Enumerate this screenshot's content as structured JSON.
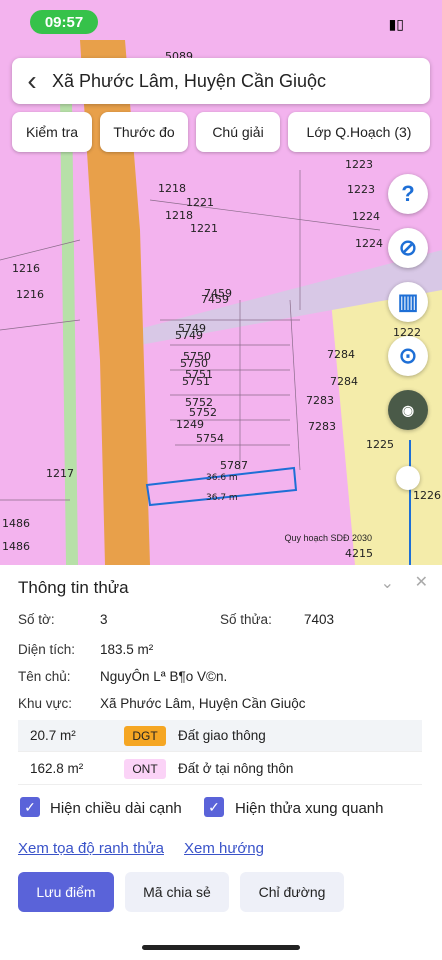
{
  "status": {
    "time": "09:57"
  },
  "header": {
    "title": "Xã Phước Lâm, Huyện Cần Giuộc"
  },
  "toolbar": {
    "check": "Kiểm tra",
    "measure": "Thước đo",
    "legend": "Chú giải",
    "layer": "Lớp Q.Hoạch (3)"
  },
  "map": {
    "labels": [
      "5089",
      "1223",
      "1218",
      "1221",
      "1223",
      "1218",
      "1221",
      "1224",
      "1224",
      "1216",
      "1216",
      "7459",
      "7459",
      "1222",
      "5749",
      "5749",
      "7284",
      "5750",
      "5750",
      "5751",
      "5751",
      "7284",
      "5752",
      "5752",
      "1249",
      "7283",
      "7283",
      "5754",
      "1225",
      "5787",
      "1217",
      "36.6 m",
      "36.7 m",
      "1226",
      "1486",
      "1486",
      "4215"
    ],
    "scale_note": "Quy hoạch SDĐ 2030"
  },
  "panel": {
    "title": "Thông tin thửa",
    "sheet_label": "Số tờ:",
    "sheet_value": "3",
    "parcel_label": "Số thửa:",
    "parcel_value": "7403",
    "area_label": "Diện tích:",
    "area_value": "183.5 m²",
    "owner_label": "Tên chủ:",
    "owner_value": "NguyÔn Lª B¶o V©n.",
    "region_label": "Khu vực:",
    "region_value": "Xã Phước Lâm, Huyện Cần Giuộc",
    "land": [
      {
        "area": "20.7 m²",
        "code": "DGT",
        "desc": "Đất giao thông",
        "color": "#f5a623"
      },
      {
        "area": "162.8 m²",
        "code": "ONT",
        "desc": "Đất ở tại nông thôn",
        "color": "#fbd3f7"
      }
    ],
    "cb_edges": "Hiện chiều dài cạnh",
    "cb_nearby": "Hiện thửa xung quanh",
    "link_coords": "Xem tọa độ ranh thửa",
    "link_direction": "Xem hướng",
    "btn_save": "Lưu điểm",
    "btn_share": "Mã chia sẻ",
    "btn_route": "Chỉ đường"
  }
}
